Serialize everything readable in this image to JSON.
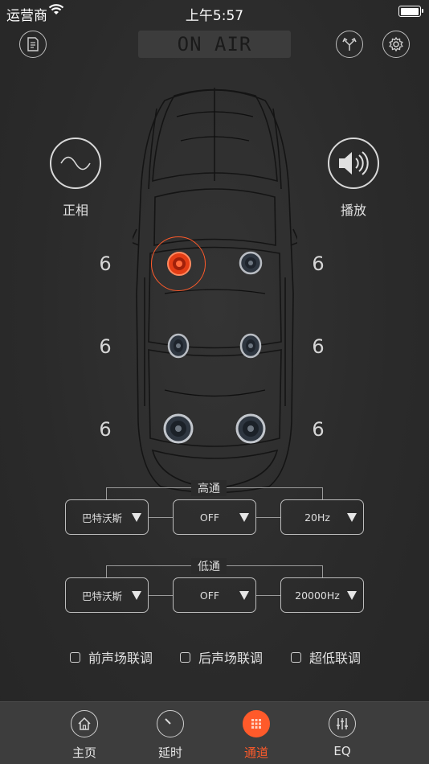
{
  "status_bar": {
    "carrier": "运营商",
    "time": "上午5:57",
    "battery_level": 1.0
  },
  "toolbar": {
    "banner": "ON AIR",
    "icons": {
      "left": "document-icon",
      "right1": "split-arrows-icon",
      "right2": "gear-icon"
    }
  },
  "phase": {
    "label": "正相",
    "icon": "sine-wave-icon"
  },
  "play": {
    "label": "播放",
    "icon": "speaker-volume-icon"
  },
  "levels": {
    "front_left": "6",
    "front_right": "6",
    "rear_left": "6",
    "rear_right": "6",
    "sub_left": "6",
    "sub_right": "6"
  },
  "colors": {
    "accent": "#ff5a2a",
    "background": "#2b2b2b",
    "tabbar": "#3d3d3d"
  },
  "high_pass": {
    "title": "高通",
    "filter_type": "巴特沃斯",
    "slope": "OFF",
    "frequency": "20Hz"
  },
  "low_pass": {
    "title": "低通",
    "filter_type": "巴特沃斯",
    "slope": "OFF",
    "frequency": "20000Hz"
  },
  "options": {
    "front_link": "前声场联调",
    "rear_link": "后声场联调",
    "sub_link": "超低联调"
  },
  "tabs": [
    {
      "label": "主页",
      "icon": "home-icon"
    },
    {
      "label": "延时",
      "icon": "dial-icon"
    },
    {
      "label": "通道",
      "icon": "grid-icon",
      "active": true
    },
    {
      "label": "EQ",
      "icon": "sliders-icon"
    }
  ]
}
